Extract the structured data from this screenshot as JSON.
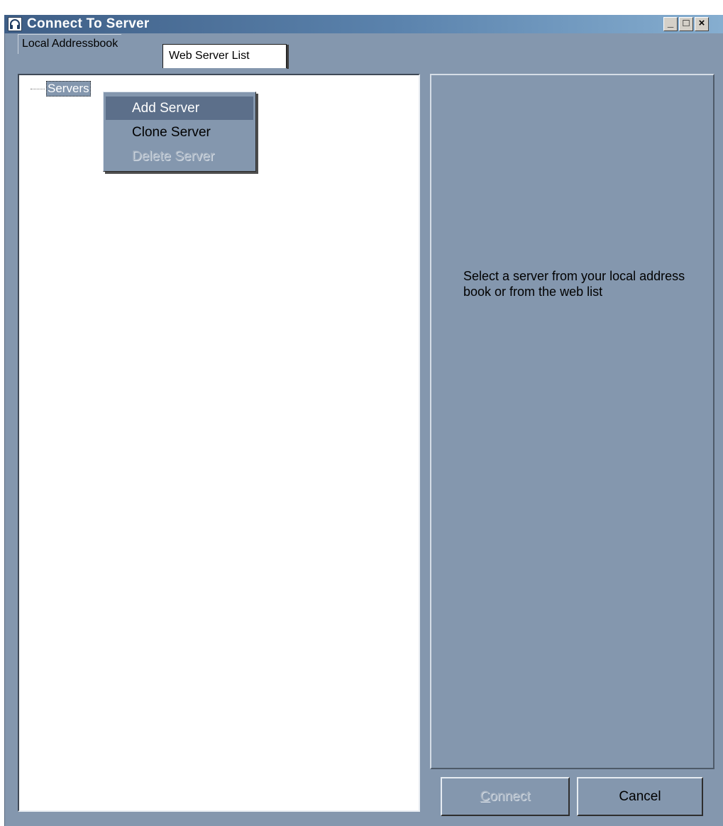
{
  "window": {
    "title": "Connect To Server",
    "app_icon": "headphones-icon",
    "controls": {
      "minimize": "_",
      "maximize": "□",
      "close": "×"
    }
  },
  "tabs": [
    {
      "label": "Local Addressbook",
      "active": true
    },
    {
      "label": "Web Server List",
      "active": false
    }
  ],
  "tree": {
    "root_label": "Servers"
  },
  "context_menu": {
    "items": [
      {
        "label": "Add Server",
        "state": "highlighted"
      },
      {
        "label": "Clone Server",
        "state": "enabled"
      },
      {
        "label": "Delete Server",
        "state": "disabled"
      }
    ]
  },
  "detail": {
    "message": "Select a server from your local address book or from the web list"
  },
  "buttons": {
    "connect": {
      "mnemonic": "C",
      "rest": "onnect",
      "enabled": false
    },
    "cancel": {
      "label": "Cancel",
      "enabled": true
    }
  },
  "colors": {
    "dialog_background": "#8497ae",
    "menu_highlight": "#5c6f8a",
    "titlebar_start": "#3e5e86",
    "titlebar_end": "#86aed0"
  }
}
